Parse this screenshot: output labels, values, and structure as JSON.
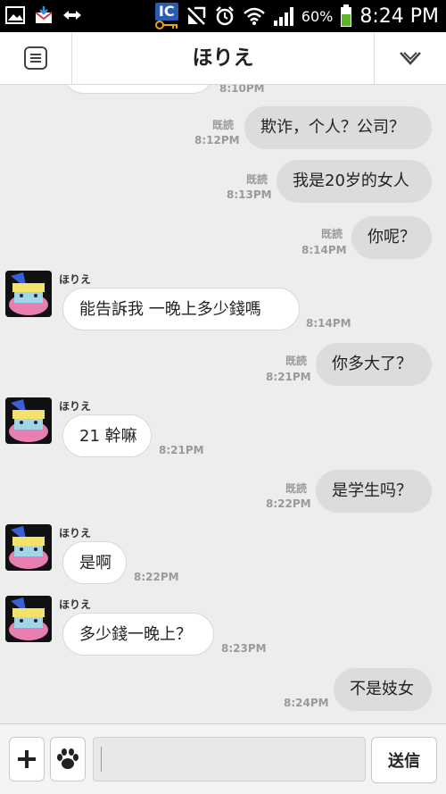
{
  "status_bar": {
    "ic_label": "IC",
    "battery_percent": "60%",
    "time": "8:24 PM",
    "icons": [
      "image-icon",
      "download-mail-icon",
      "sync-arrows-icon",
      "key-icon",
      "no-signal-icon",
      "alarm-icon",
      "wifi-icon",
      "cell-signal-icon",
      "battery-icon"
    ]
  },
  "header": {
    "title": "ほりえ",
    "left_icon": "menu-icon",
    "right_icon": "chevron-down-icon"
  },
  "partial_top": {
    "time": "8:10PM"
  },
  "read_label": "既読",
  "messages": [
    {
      "dir": "out",
      "text": "欺诈，个人？公司？",
      "time": "8:12PM",
      "read": "既読"
    },
    {
      "dir": "out",
      "text": "我是20岁的女人",
      "time": "8:13PM",
      "read": "既読"
    },
    {
      "dir": "out",
      "text": "你呢？",
      "time": "8:14PM",
      "read": "既読"
    },
    {
      "dir": "in",
      "sender": "ほりえ",
      "text": "能告訴我 一晚上多少錢嗎",
      "time": "8:14PM"
    },
    {
      "dir": "out",
      "text": "你多大了？",
      "time": "8:21PM",
      "read": "既読"
    },
    {
      "dir": "in",
      "sender": "ほりえ",
      "text": "21 幹嘛",
      "time": "8:21PM"
    },
    {
      "dir": "out",
      "text": "是学生吗？",
      "time": "8:22PM",
      "read": "既読"
    },
    {
      "dir": "in",
      "sender": "ほりえ",
      "text": "是啊",
      "time": "8:22PM"
    },
    {
      "dir": "in",
      "sender": "ほりえ",
      "text": "多少錢一晚上？",
      "time": "8:23PM"
    },
    {
      "dir": "out",
      "text": "不是妓女",
      "time": "8:24PM"
    }
  ],
  "composer": {
    "plus_icon": "plus-icon",
    "paw_icon": "paw-icon",
    "input_value": "",
    "send_label": "送信"
  }
}
